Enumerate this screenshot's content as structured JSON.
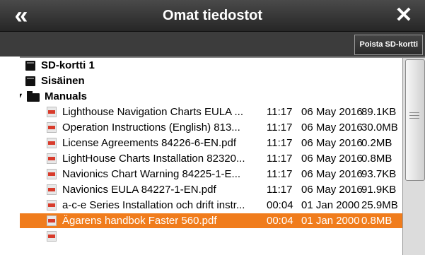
{
  "header": {
    "title": "Omat tiedostot"
  },
  "toolbar": {
    "eject_sd_label": "Poista SD-kortti"
  },
  "tree": [
    {
      "kind": "sd",
      "label": "SD-kortti 1"
    },
    {
      "kind": "folder-root",
      "expanded": true,
      "label": "Sisäinen"
    },
    {
      "kind": "folder",
      "expanded": true,
      "label": "Manuals"
    }
  ],
  "files": [
    {
      "name": "Lighthouse Navigation Charts EULA ...",
      "time": "11:17",
      "date": "06 May 2016",
      "size": "89.1KB"
    },
    {
      "name": "Operation Instructions (English) 813...",
      "time": "11:17",
      "date": "06 May 2016",
      "size": "30.0MB"
    },
    {
      "name": "License Agreements 84226-6-EN.pdf",
      "time": "11:17",
      "date": "06 May 2016",
      "size": "0.2MB"
    },
    {
      "name": "LightHouse Charts Installation 82320...",
      "time": "11:17",
      "date": "06 May 2016",
      "size": "0.8MB"
    },
    {
      "name": "Navionics Chart Warning 84225-1-E...",
      "time": "11:17",
      "date": "06 May 2016",
      "size": "93.7KB"
    },
    {
      "name": "Navionics EULA 84227-1-EN.pdf",
      "time": "11:17",
      "date": "06 May 2016",
      "size": "91.9KB"
    },
    {
      "name": "a-c-e Series Installation och drift instr...",
      "time": "00:04",
      "date": "01 Jan 2000",
      "size": "25.9MB"
    },
    {
      "name": "Ägarens handbok Faster 560.pdf",
      "time": "00:04",
      "date": "01 Jan 2000",
      "size": "0.8MB",
      "selected": true
    }
  ],
  "colors": {
    "selection": "#f07c1c",
    "titlebar": "#333333",
    "toolbar": "#3c3c3c"
  },
  "icons": {
    "back": "double-chevron-left-icon",
    "close": "close-icon",
    "sd": "sd-card-icon",
    "folder": "folder-icon",
    "file": "pdf-file-icon"
  }
}
